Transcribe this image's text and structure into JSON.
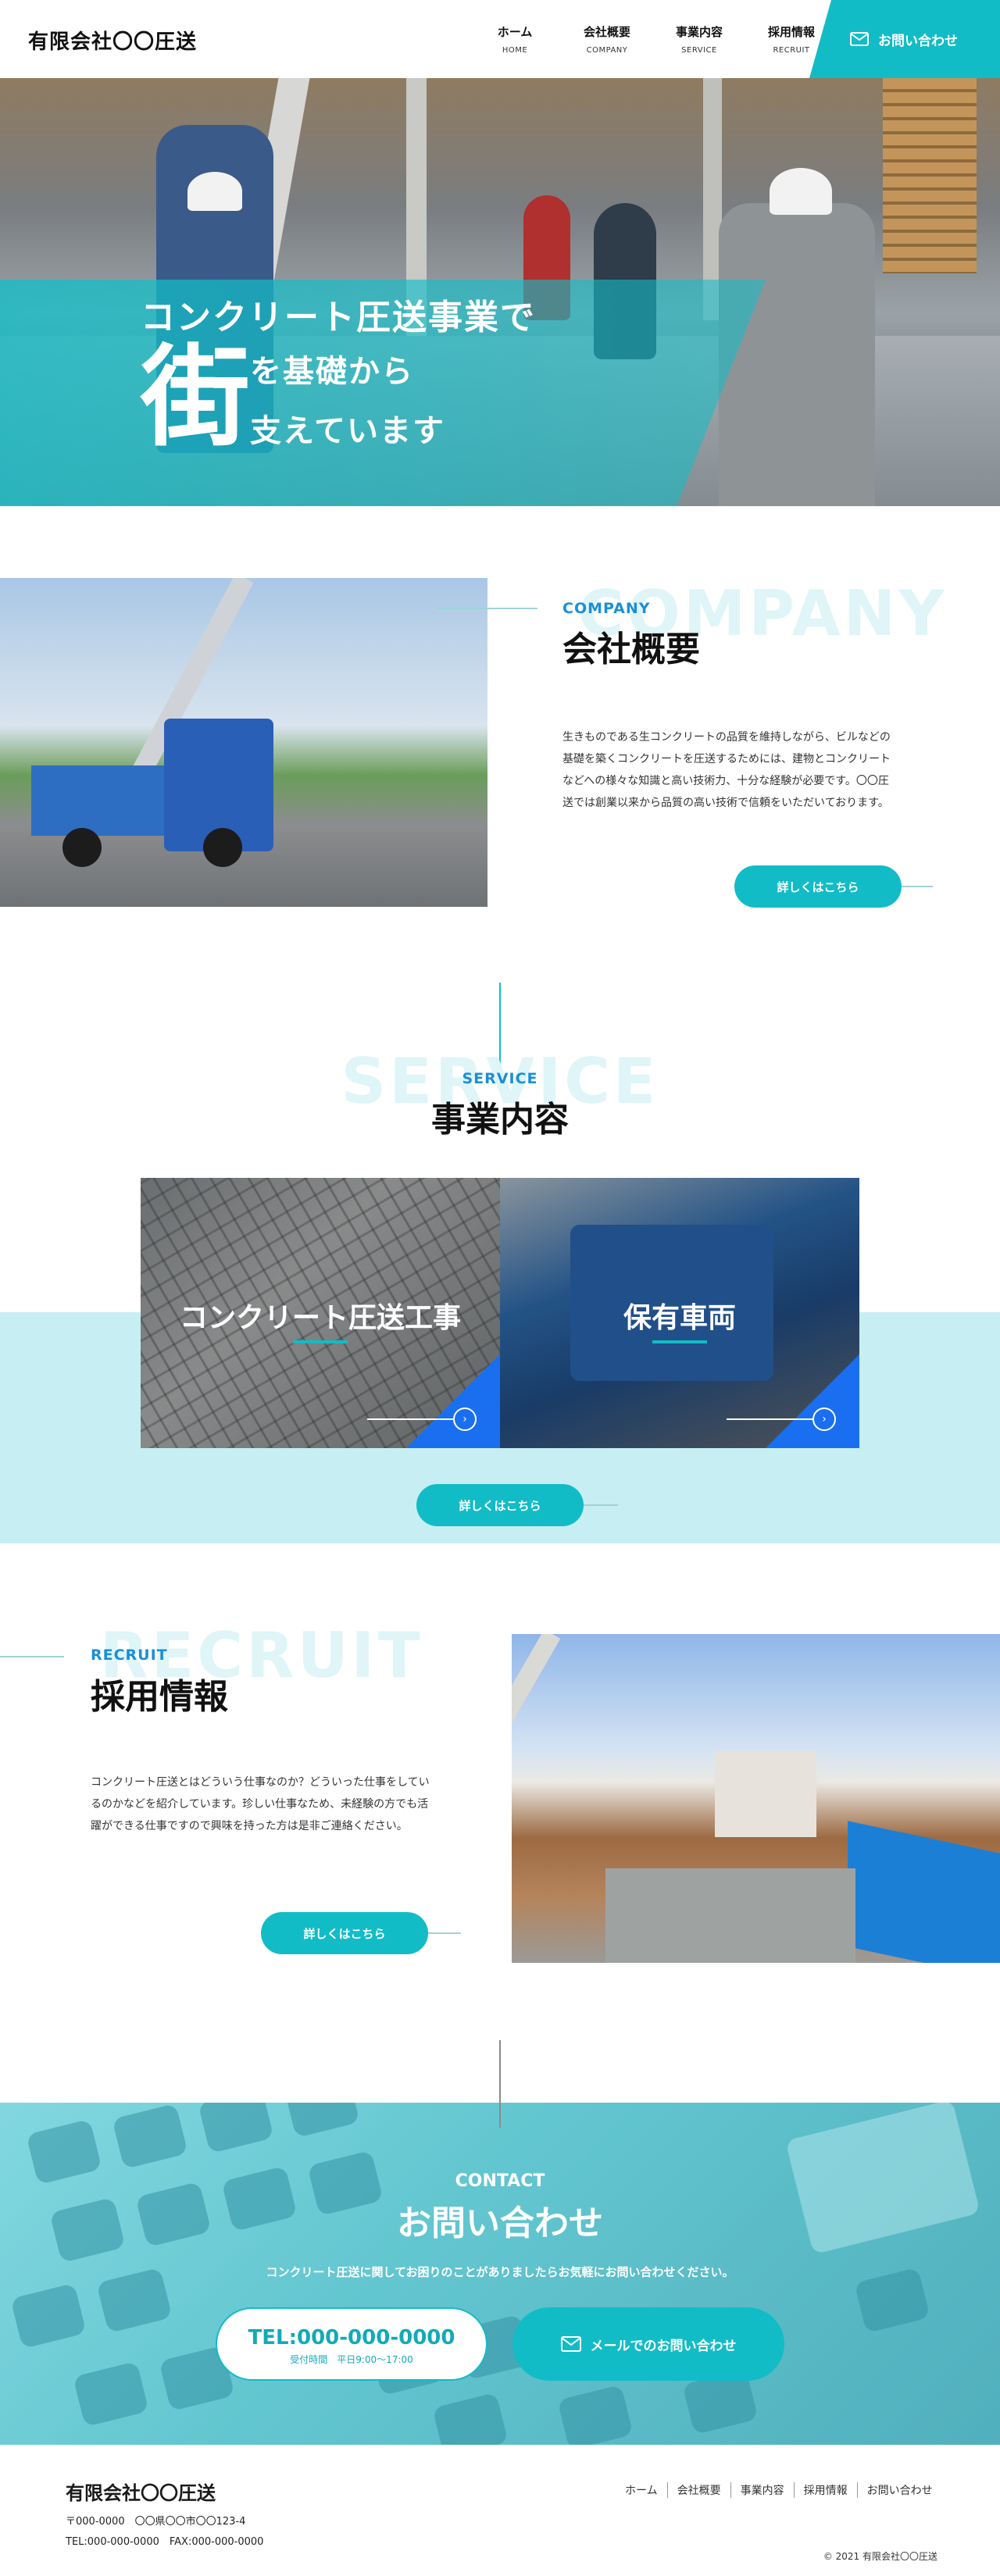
{
  "header": {
    "logo": "有限会社〇〇圧送",
    "nav": [
      {
        "jp": "ホーム",
        "en": "HOME"
      },
      {
        "jp": "会社概要",
        "en": "COMPANY"
      },
      {
        "jp": "事業内容",
        "en": "SERVICE"
      },
      {
        "jp": "採用情報",
        "en": "RECRUIT"
      }
    ],
    "contact_label": "お問い合わせ"
  },
  "hero": {
    "line1": "コンクリート圧送事業で",
    "big": "街",
    "line2": "を基礎から",
    "line3": "支えています"
  },
  "company": {
    "en_ghost": "COMPANY",
    "en": "COMPANY",
    "title": "会社概要",
    "text": "生きものである生コンクリートの品質を維持しながら、ビルなどの基礎を築くコンクリートを圧送するためには、建物とコンクリートなどへの様々な知識と高い技術力、十分な経験が必要です。〇〇圧送では創業以来から品質の高い技術で信頼をいただいております。",
    "button": "詳しくはこちら"
  },
  "service": {
    "en_ghost": "SERVICE",
    "en": "SERVICE",
    "title": "事業内容",
    "cards": [
      {
        "title": "コンクリート圧送工事"
      },
      {
        "title": "保有車両"
      }
    ],
    "button": "詳しくはこちら"
  },
  "recruit": {
    "en_ghost": "RECRUIT",
    "en": "RECRUIT",
    "title": "採用情報",
    "text": "コンクリート圧送とはどういう仕事なのか？どういった仕事をしているのかなどを紹介しています。珍しい仕事なため、未経験の方でも活躍ができる仕事ですので興味を持った方は是非ご連絡ください。",
    "button": "詳しくはこちら"
  },
  "contact": {
    "en": "CONTACT",
    "title": "お問い合わせ",
    "lead": "コンクリート圧送に関してお困りのことがありましたらお気軽にお問い合わせください。",
    "tel": "TEL:000-000-0000",
    "hours": "受付時間　平日9:00～17:00",
    "mail": "メールでのお問い合わせ"
  },
  "footer": {
    "logo": "有限会社〇〇圧送",
    "address": "〒000-0000　〇〇県〇〇市〇〇123-4",
    "telfax": "TEL:000-000-0000　FAX:000-000-0000",
    "nav": [
      "ホーム",
      "会社概要",
      "事業内容",
      "採用情報",
      "お問い合わせ"
    ],
    "copyright": "© 2021 有限会社〇〇圧送"
  },
  "colors": {
    "accent": "#12bcc6",
    "blue": "#1a8fd8",
    "light_band": "#c7eff3"
  }
}
